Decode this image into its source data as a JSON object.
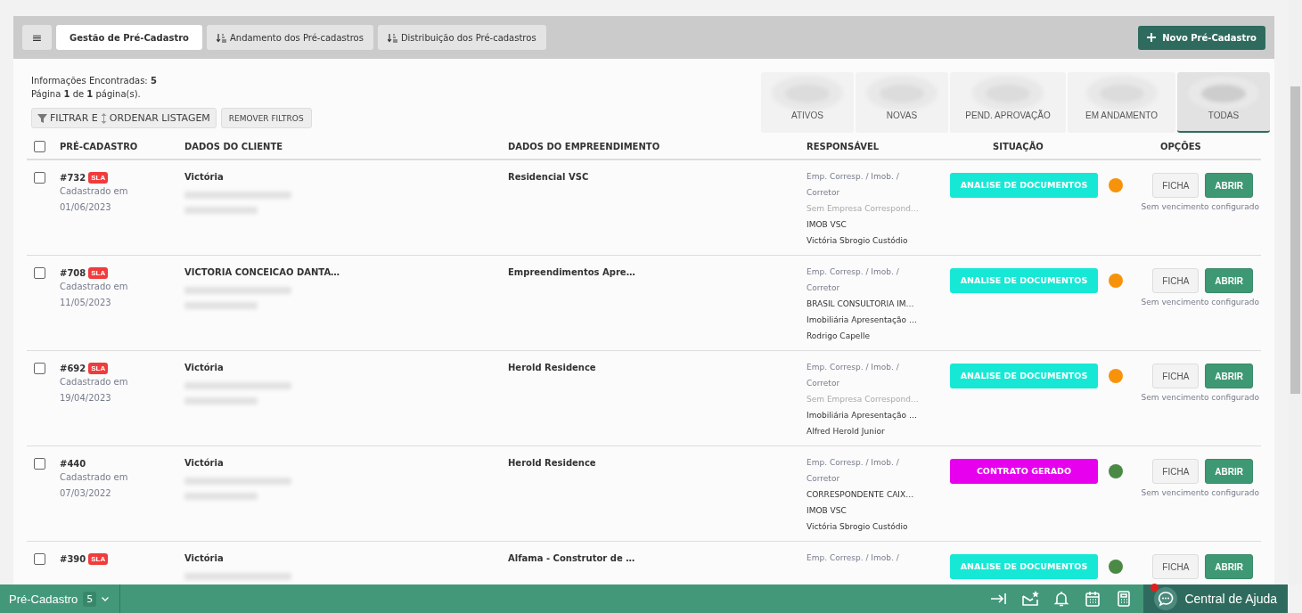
{
  "top_bar": {
    "menu_icon": "≡",
    "tabs": [
      {
        "label": "Gestão de Pré-Cadastro",
        "selected": true,
        "kind": "plain"
      },
      {
        "label": "Andamento dos Pré-cadastros",
        "selected": false,
        "kind": "sorted"
      },
      {
        "label": "Distribuição dos Pré-cadastros",
        "selected": false,
        "kind": "sorted"
      }
    ],
    "new_button": "Novo Pré-Cadastro"
  },
  "summary": {
    "found": "Informações Encontradas: **5**",
    "page": "Página **1** de **1** página(s).",
    "filter_button": {
      "label_1": "FILTRAR E",
      "label_2": "ORDENAR LISTAGEM"
    },
    "remove_button": "REMOVER FILTROS"
  },
  "status_tiles": [
    {
      "label": "ATIVOS",
      "selected": false
    },
    {
      "label": "NOVAS",
      "selected": false
    },
    {
      "label": "PEND. APROVAÇÃO",
      "selected": false
    },
    {
      "label": "EM ANDAMENTO",
      "selected": false
    },
    {
      "label": "TODAS",
      "selected": true
    }
  ],
  "table": {
    "select_all_checked": false,
    "columns": [
      "PRÉ-CADASTRO",
      "DADOS DO CLIENTE",
      "DADOS DO EMPREENDIMENTO",
      "RESPONSÁVEL",
      "SITUAÇÃO",
      "OPÇÕES"
    ],
    "rows": [
      {
        "checked": false,
        "code": "#732",
        "sla": "SLA",
        "registered_label": "Cadastrado em",
        "date": "01/06/2023",
        "client": "Victória",
        "project": "Residencial VSC",
        "responsible_label": "Emp. Corresp. / Imob. / Corretor",
        "responsible": [
          {
            "text": "Sem Empresa Correspond…",
            "muted": true
          },
          {
            "text": "IMOB VSC",
            "muted": false
          },
          {
            "text": "Victória Sbrogio Custódio",
            "muted": false
          }
        ],
        "status": {
          "label": "ANALISE DE DOCUMENTOS",
          "color": "#17e8d6"
        },
        "dot": {
          "color": "#f7930a"
        },
        "buttons": [
          "FICHA",
          "ABRIR"
        ],
        "due_note": "Sem vencimento configurado"
      },
      {
        "checked": false,
        "code": "#708",
        "sla": "SLA",
        "registered_label": "Cadastrado em",
        "date": "11/05/2023",
        "client": "VICTORIA CONCEICAO DANTA…",
        "project": "Empreendimentos Apre…",
        "responsible_label": "Emp. Corresp. / Imob. / Corretor",
        "responsible": [
          {
            "text": "BRASIL CONSULTORIA IM…",
            "muted": false
          },
          {
            "text": "Imobiliária Apresentação …",
            "muted": false
          },
          {
            "text": "Rodrigo Capelle",
            "muted": false
          }
        ],
        "status": {
          "label": "ANALISE DE DOCUMENTOS",
          "color": "#17e8d6"
        },
        "dot": {
          "color": "#f7930a"
        },
        "buttons": [
          "FICHA",
          "ABRIR"
        ],
        "due_note": "Sem vencimento configurado"
      },
      {
        "checked": false,
        "code": "#692",
        "sla": "SLA",
        "registered_label": "Cadastrado em",
        "date": "19/04/2023",
        "client": "Victória",
        "project": "Herold Residence",
        "responsible_label": "Emp. Corresp. / Imob. / Corretor",
        "responsible": [
          {
            "text": "Sem Empresa Correspond…",
            "muted": true
          },
          {
            "text": "Imobiliária Apresentação …",
            "muted": false
          },
          {
            "text": "Alfred Herold Junior",
            "muted": false
          }
        ],
        "status": {
          "label": "ANALISE DE DOCUMENTOS",
          "color": "#17e8d6"
        },
        "dot": {
          "color": "#f7930a"
        },
        "buttons": [
          "FICHA",
          "ABRIR"
        ],
        "due_note": "Sem vencimento configurado"
      },
      {
        "checked": false,
        "code": "#440",
        "registered_label": "Cadastrado em",
        "date": "07/03/2022",
        "client": "Victória",
        "project": "Herold Residence",
        "responsible_label": "Emp. Corresp. / Imob. / Corretor",
        "responsible": [
          {
            "text": "CORRESPONDENTE CAIX…",
            "muted": false
          },
          {
            "text": "IMOB VSC",
            "muted": false
          },
          {
            "text": "Victória Sbrogio Custódio",
            "muted": false
          }
        ],
        "status": {
          "label": "CONTRATO GERADO",
          "color": "#e600ee"
        },
        "dot": {
          "color": "#4a8a45"
        },
        "buttons": [
          "FICHA",
          "ABRIR"
        ],
        "due_note": "Sem vencimento configurado"
      },
      {
        "checked": false,
        "code": "#390",
        "sla": "SLA",
        "client": "Victória",
        "project": "Alfama - Construtor de …",
        "responsible_label": "Emp. Corresp. / Imob. /",
        "status": {
          "label": "ANALISE DE DOCUMENTOS",
          "color": "#17e8d6"
        },
        "dot": {
          "color": "#4a8a45"
        },
        "buttons": [
          "FICHA",
          "ABRIR"
        ]
      }
    ]
  },
  "bottom_bar": {
    "module": "Pré-Cadastro",
    "count": "5",
    "help": "Central de Ajuda",
    "help_notification": true
  }
}
